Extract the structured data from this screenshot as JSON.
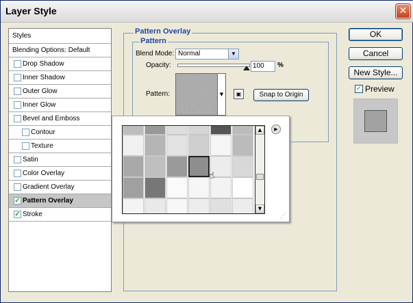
{
  "window": {
    "title": "Layer Style",
    "close_glyph": "✕"
  },
  "styles_panel": {
    "header": "Styles",
    "blending": "Blending Options: Default",
    "items": [
      {
        "label": "Drop Shadow",
        "checked": false,
        "indent": false,
        "selected": false
      },
      {
        "label": "Inner Shadow",
        "checked": false,
        "indent": false,
        "selected": false
      },
      {
        "label": "Outer Glow",
        "checked": false,
        "indent": false,
        "selected": false
      },
      {
        "label": "Inner Glow",
        "checked": false,
        "indent": false,
        "selected": false
      },
      {
        "label": "Bevel and Emboss",
        "checked": false,
        "indent": false,
        "selected": false
      },
      {
        "label": "Contour",
        "checked": false,
        "indent": true,
        "selected": false
      },
      {
        "label": "Texture",
        "checked": false,
        "indent": true,
        "selected": false
      },
      {
        "label": "Satin",
        "checked": false,
        "indent": false,
        "selected": false
      },
      {
        "label": "Color Overlay",
        "checked": false,
        "indent": false,
        "selected": false
      },
      {
        "label": "Gradient Overlay",
        "checked": false,
        "indent": false,
        "selected": false
      },
      {
        "label": "Pattern Overlay",
        "checked": true,
        "indent": false,
        "selected": true
      },
      {
        "label": "Stroke",
        "checked": true,
        "indent": false,
        "selected": false
      }
    ],
    "check_glyph": "✓"
  },
  "pattern_overlay": {
    "group_title": "Pattern Overlay",
    "sub_title": "Pattern",
    "blend_mode_label": "Blend Mode:",
    "blend_mode_value": "Normal",
    "opacity_label": "Opacity:",
    "opacity_value": "100",
    "opacity_unit": "%",
    "pattern_label": "Pattern:",
    "snap_button": "Snap to Origin"
  },
  "buttons": {
    "ok": "OK",
    "cancel": "Cancel",
    "new_style": "New Style...",
    "preview": "Preview"
  },
  "pattern_picker": {
    "selected_row": 2,
    "selected_col": 3
  },
  "glyphs": {
    "dropdown": "▼",
    "up": "▲",
    "down": "▼",
    "menu": "▶",
    "grip": "⋰",
    "hand": "☝"
  }
}
